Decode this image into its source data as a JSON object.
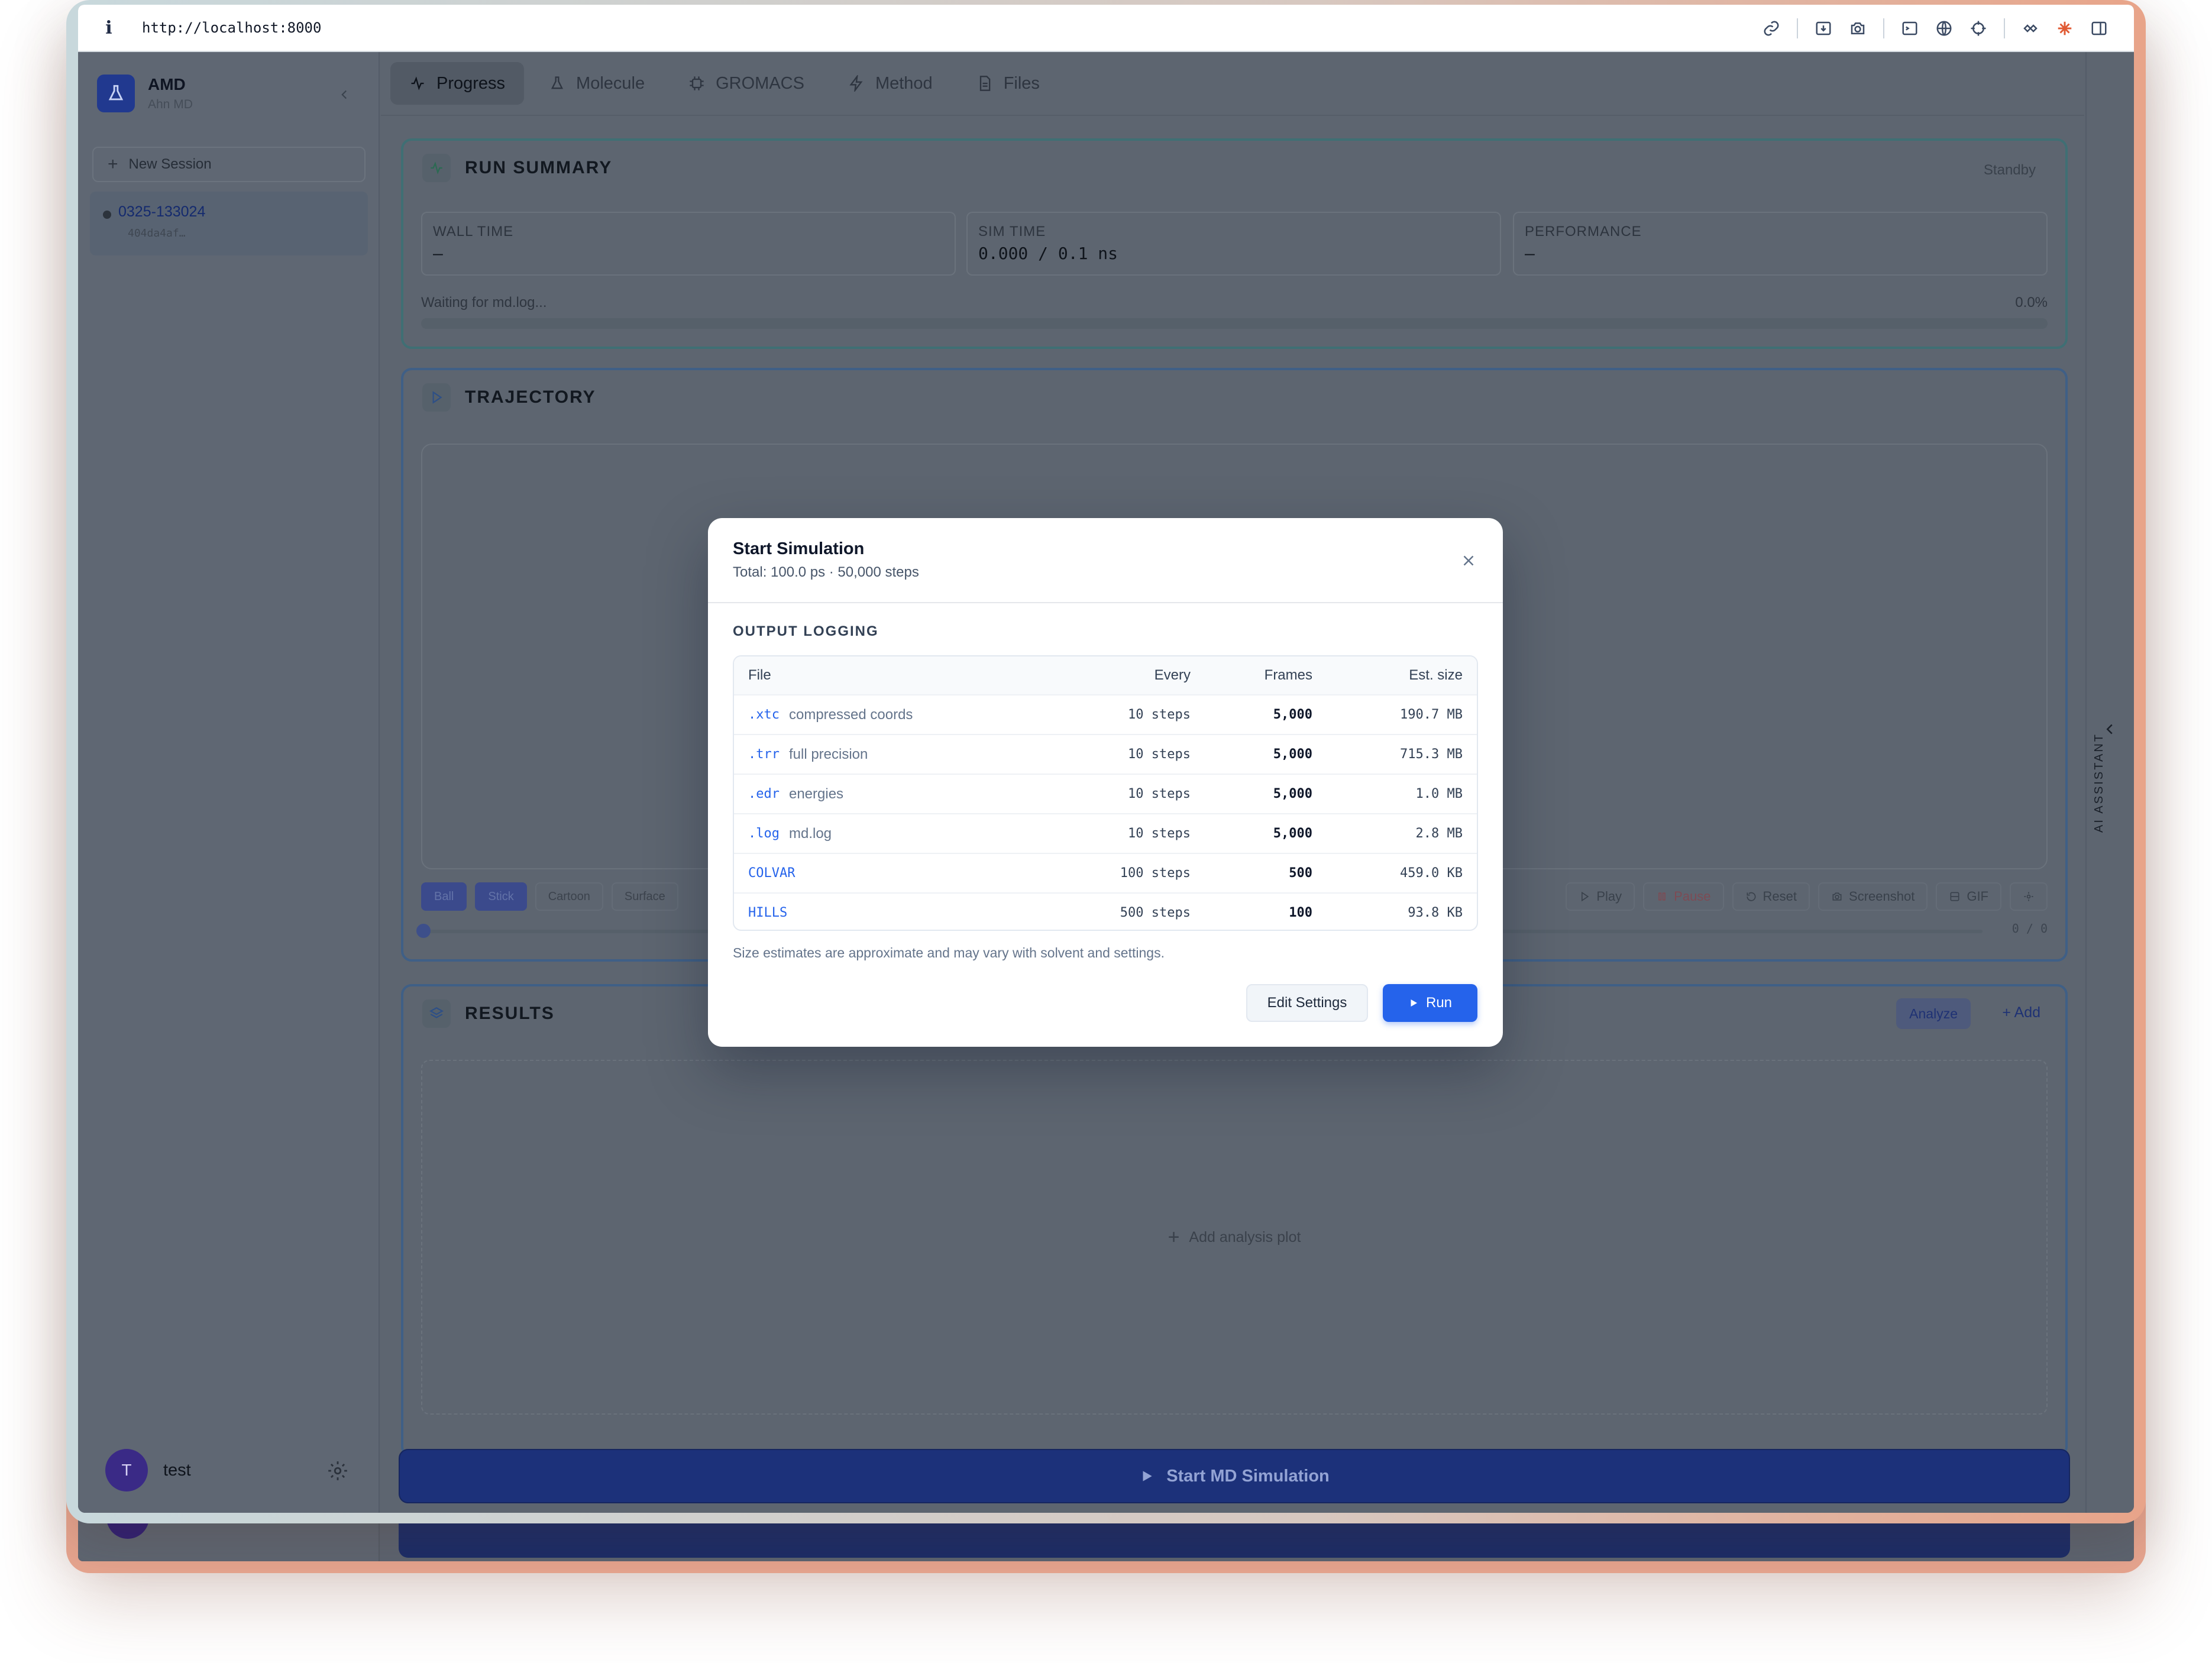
{
  "browser": {
    "url": "http://localhost:8000"
  },
  "sidebar": {
    "brand_title": "AMD",
    "brand_subtitle": "Ahn MD",
    "new_session_label": "New Session",
    "session_id": "0325-133024",
    "session_hash": "404da4af…",
    "user_initial": "T",
    "user_name": "test"
  },
  "tabs": [
    "Progress",
    "Molecule",
    "GROMACS",
    "Method",
    "Files"
  ],
  "run_summary": {
    "title": "RUN SUMMARY",
    "status": "Standby",
    "wall_time_label": "WALL TIME",
    "wall_time_value": "—",
    "sim_time_label": "SIM TIME",
    "sim_time_value": "0.000 / 0.1 ns",
    "performance_label": "PERFORMANCE",
    "performance_value": "—",
    "waiting_text": "Waiting for md.log...",
    "progress_text": "0.0%",
    "progress_fraction": 0.0
  },
  "trajectory": {
    "title": "TRAJECTORY",
    "styles": [
      "Ball",
      "Stick",
      "Cartoon",
      "Surface"
    ],
    "controls": {
      "play": "Play",
      "pause": "Pause",
      "reset": "Reset",
      "screenshot": "Screenshot",
      "gif": "GIF"
    },
    "frame_counter": "0 / 0"
  },
  "results": {
    "title": "RESULTS",
    "analyze_label": "Analyze",
    "add_label": "Add",
    "empty_label": "Add analysis plot"
  },
  "start_button_label": "Start MD Simulation",
  "assistant_label": "AI ASSISTANT",
  "modal": {
    "title": "Start Simulation",
    "subtitle": "Total: 100.0 ps · 50,000 steps",
    "section_label": "OUTPUT LOGGING",
    "columns": {
      "file": "File",
      "every": "Every",
      "frames": "Frames",
      "size": "Est. size"
    },
    "rows": [
      {
        "ext": ".xtc",
        "desc": "compressed coords",
        "every": "10 steps",
        "frames": "5,000",
        "size": "190.7 MB"
      },
      {
        "ext": ".trr",
        "desc": "full precision",
        "every": "10 steps",
        "frames": "5,000",
        "size": "715.3 MB"
      },
      {
        "ext": ".edr",
        "desc": "energies",
        "every": "10 steps",
        "frames": "5,000",
        "size": "1.0 MB"
      },
      {
        "ext": ".log",
        "desc": "md.log",
        "every": "10 steps",
        "frames": "5,000",
        "size": "2.8 MB"
      },
      {
        "ext": "COLVAR",
        "desc": "",
        "every": "100 steps",
        "frames": "500",
        "size": "459.0 KB"
      },
      {
        "ext": "HILLS",
        "desc": "",
        "every": "500 steps",
        "frames": "100",
        "size": "93.8 KB"
      }
    ],
    "note": "Size estimates are approximate and may vary with solvent and settings.",
    "edit_label": "Edit Settings",
    "run_label": "Run"
  },
  "colors": {
    "accent": "#2563eb",
    "run_summary_border": "#3f6f74",
    "brand": "#21398f"
  }
}
